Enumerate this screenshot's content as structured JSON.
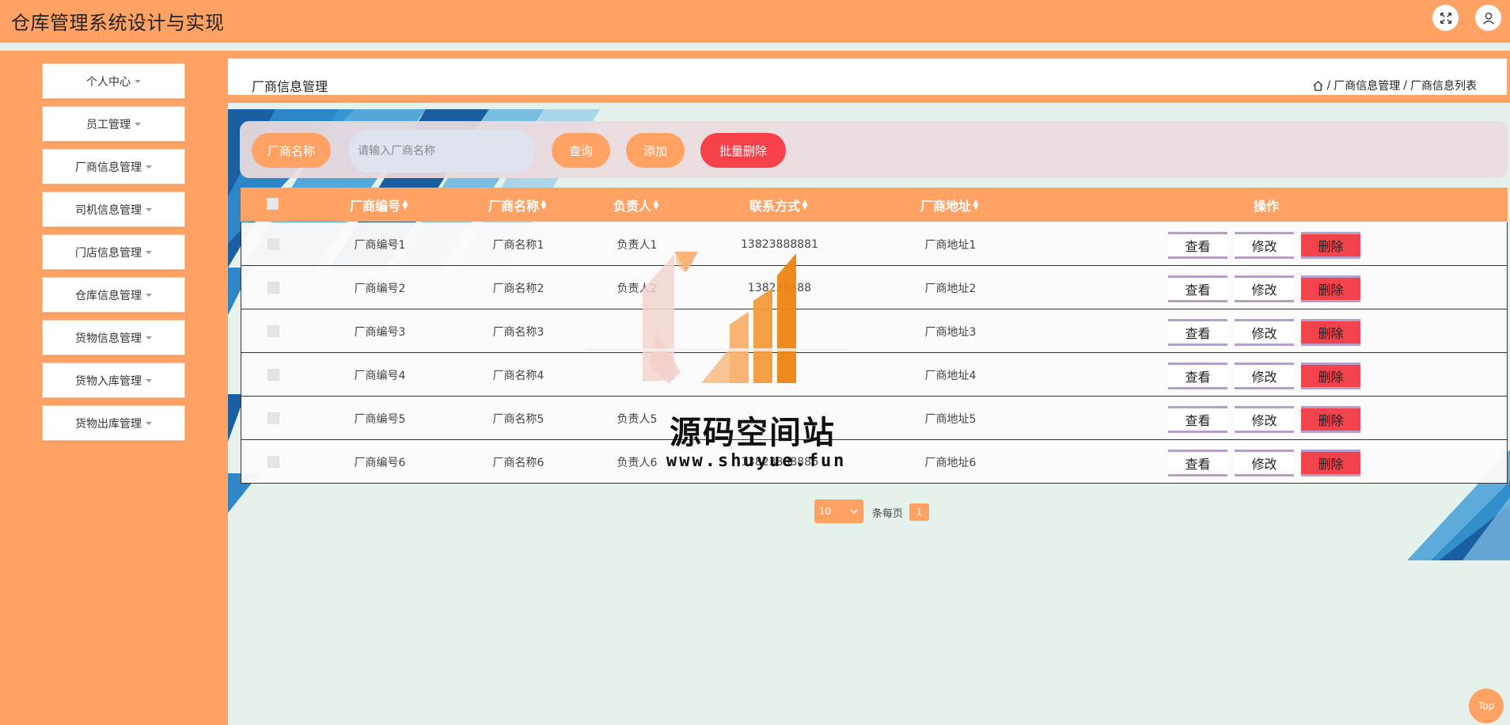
{
  "header": {
    "app_title": "仓库管理系统设计与实现",
    "fullscreen_icon": "fullscreen-icon",
    "user_icon": "user-icon"
  },
  "sidebar": {
    "items": [
      {
        "label": "个人中心"
      },
      {
        "label": "员工管理"
      },
      {
        "label": "厂商信息管理"
      },
      {
        "label": "司机信息管理"
      },
      {
        "label": "门店信息管理"
      },
      {
        "label": "仓库信息管理"
      },
      {
        "label": "货物信息管理"
      },
      {
        "label": "货物入库管理"
      },
      {
        "label": "货物出库管理"
      }
    ]
  },
  "breadcrumb": {
    "page_title": "厂商信息管理",
    "path": [
      "厂商信息管理",
      "厂商信息列表"
    ],
    "separator": "/"
  },
  "search": {
    "label": "厂商名称",
    "placeholder": "请输入厂商名称",
    "query_label": "查询",
    "add_label": "添加",
    "batch_delete_label": "批量删除"
  },
  "table": {
    "columns": [
      "厂商编号",
      "厂商名称",
      "负责人",
      "联系方式",
      "厂商地址",
      "操作"
    ],
    "rows": [
      {
        "code": "厂商编号1",
        "name": "厂商名称1",
        "owner": "负责人1",
        "phone": "13823888881",
        "address": "厂商地址1"
      },
      {
        "code": "厂商编号2",
        "name": "厂商名称2",
        "owner": "负责人2",
        "phone": "138238888",
        "address": "厂商地址2"
      },
      {
        "code": "厂商编号3",
        "name": "厂商名称3",
        "owner": "",
        "phone": "",
        "address": "厂商地址3"
      },
      {
        "code": "厂商编号4",
        "name": "厂商名称4",
        "owner": "",
        "phone": "",
        "address": "厂商地址4"
      },
      {
        "code": "厂商编号5",
        "name": "厂商名称5",
        "owner": "负责人5",
        "phone": "",
        "address": "厂商地址5"
      },
      {
        "code": "厂商编号6",
        "name": "厂商名称6",
        "owner": "负责人6",
        "phone": "13823888886",
        "address": "厂商地址6"
      }
    ],
    "actions": {
      "view": "查看",
      "edit": "修改",
      "delete": "删除"
    }
  },
  "pagination": {
    "page_size": "10",
    "page_size_label": "条每页",
    "current_page": "1"
  },
  "watermark": {
    "title": "源码空间站",
    "url": "www.shuyue.fun"
  },
  "back_to_top": "Top",
  "colors": {
    "accent": "#ffa264",
    "danger": "#f2424c",
    "background": "#e5f1eb"
  }
}
